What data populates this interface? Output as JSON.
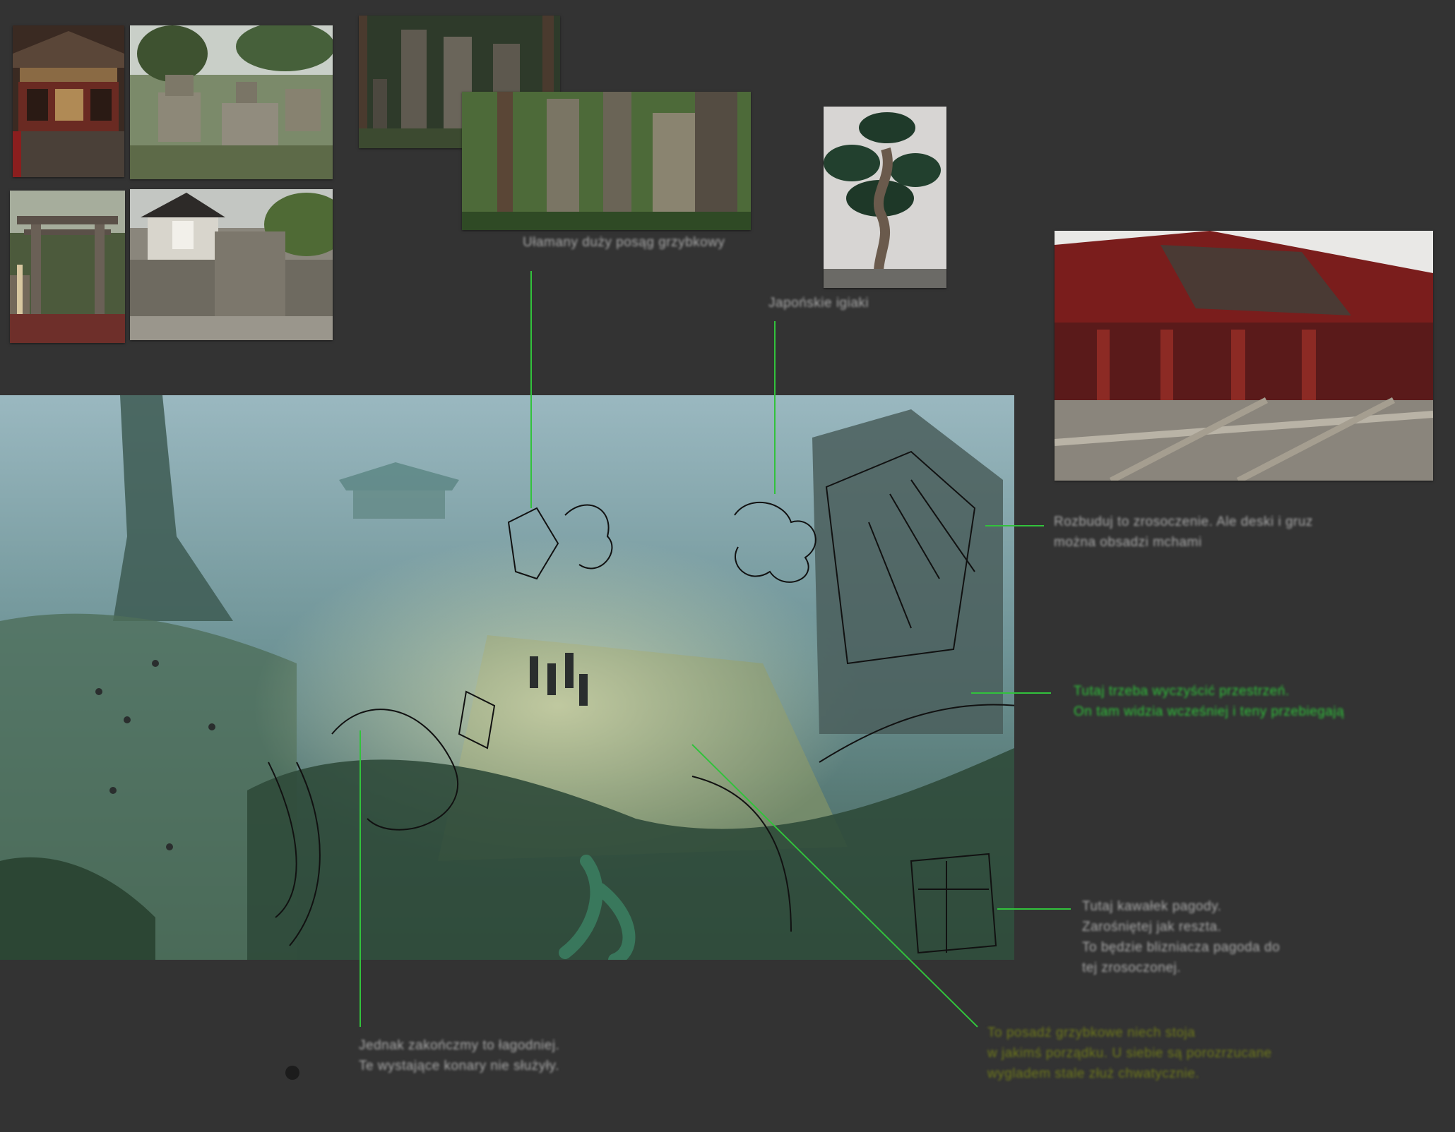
{
  "board": {
    "background": "#333333",
    "leader_color": "#32c23c",
    "sketch_color": "#111111"
  },
  "references": [
    {
      "name": "ref-shrine-ornate",
      "subject": "ornate red shrine"
    },
    {
      "name": "ref-stone-cemetery",
      "subject": "mossy stone cemetery"
    },
    {
      "name": "ref-torii-gate",
      "subject": "stone torii gate"
    },
    {
      "name": "ref-small-shrine-steps",
      "subject": "small shrine on stone steps"
    },
    {
      "name": "ref-stone-pagodas",
      "subject": "stone grave pagodas in forest"
    },
    {
      "name": "ref-moss-pagodas",
      "subject": "moss covered stone pagodas"
    },
    {
      "name": "ref-japanese-pine",
      "subject": "Japanese pine tree"
    },
    {
      "name": "ref-ruined-red-temple",
      "subject": "collapsed red temple"
    }
  ],
  "notes": {
    "n1": {
      "lines": [
        "Ułamany duży posąg grzybkowy"
      ]
    },
    "n2": {
      "lines": [
        "Japońskie igiaki"
      ]
    },
    "n3": {
      "lines": [
        "Rozbuduj to zrosoczenie. Ale deski i gruz",
        "można obsadzi mchami"
      ]
    },
    "n4": {
      "lines": [
        "Tutaj trzeba wyczyścić przestrzeń.",
        "On tam widzia wcześniej i teny przebiegają"
      ]
    },
    "n5": {
      "lines": [
        "Tutaj kawałek pagody.",
        "Zarośniętej jak reszta.",
        "To będzie blizniacza pagoda do",
        "tej zrosoczonej."
      ]
    },
    "n6": {
      "lines": [
        "To posadź grzybkowe niech stoja",
        "w jakimś porządku. U siebie są porozrzucane",
        "wygladem stale złuż chwatycznie."
      ]
    },
    "n7": {
      "lines": [
        "Jednak zakończmy to łagodniej.",
        "Te wystające konary nie służyły."
      ]
    }
  }
}
